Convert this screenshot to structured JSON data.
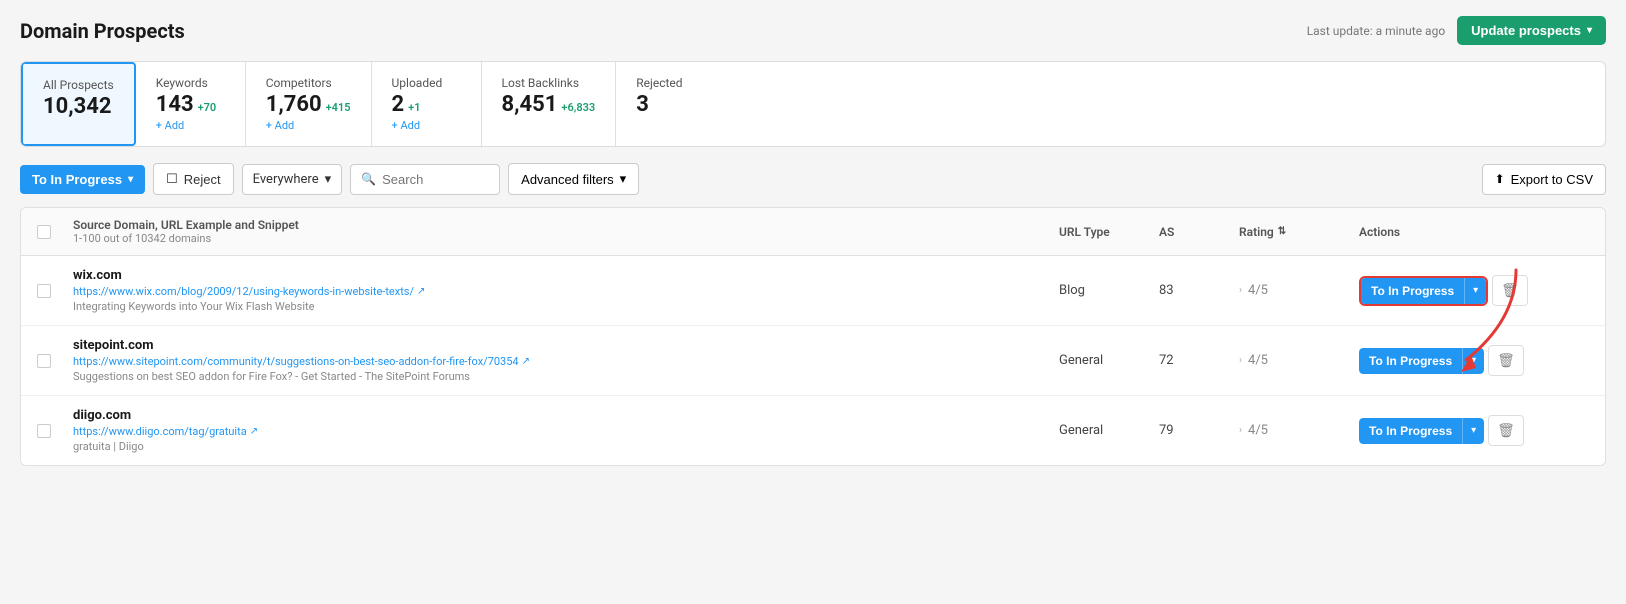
{
  "page": {
    "title": "Domain Prospects",
    "last_update": "Last update: a minute ago",
    "update_btn": "Update prospects"
  },
  "stats": [
    {
      "id": "all",
      "label": "All Prospects",
      "value": "10,342",
      "delta": "",
      "add": "",
      "active": true
    },
    {
      "id": "keywords",
      "label": "Keywords",
      "value": "143",
      "delta": "+70",
      "add": "+ Add",
      "active": false
    },
    {
      "id": "competitors",
      "label": "Competitors",
      "value": "1,760",
      "delta": "+415",
      "add": "+ Add",
      "active": false
    },
    {
      "id": "uploaded",
      "label": "Uploaded",
      "value": "2",
      "delta": "+1",
      "add": "+ Add",
      "active": false
    },
    {
      "id": "lost_backlinks",
      "label": "Lost Backlinks",
      "value": "8,451",
      "delta": "+6,833",
      "add": "",
      "active": false
    },
    {
      "id": "rejected",
      "label": "Rejected",
      "value": "3",
      "delta": "",
      "add": "",
      "active": false
    }
  ],
  "toolbar": {
    "to_in_progress": "To In Progress",
    "reject": "Reject",
    "everywhere": "Everywhere",
    "search_placeholder": "Search",
    "advanced_filters": "Advanced filters",
    "export": "Export to CSV"
  },
  "table": {
    "col_source": "Source Domain, URL Example and Snippet",
    "col_source_sub": "1-100 out of 10342 domains",
    "col_url_type": "URL Type",
    "col_as": "AS",
    "col_rating": "Rating",
    "col_actions": "Actions",
    "rows": [
      {
        "domain": "wix.com",
        "url": "https://www.wix.com/blog/2009/12/using-keywords-in-website-texts/",
        "snippet": "Integrating Keywords into Your Wix Flash Website",
        "url_type": "Blog",
        "as": "83",
        "rating": "4/5",
        "action": "To In Progress",
        "highlighted": true
      },
      {
        "domain": "sitepoint.com",
        "url": "https://www.sitepoint.com/community/t/suggestions-on-best-seo-addon-for-fire-fox/70354",
        "snippet": "Suggestions on best SEO addon for Fire Fox? - Get Started - The SitePoint Forums",
        "url_type": "General",
        "as": "72",
        "rating": "4/5",
        "action": "To In Progress",
        "highlighted": false
      },
      {
        "domain": "diigo.com",
        "url": "https://www.diigo.com/tag/gratuita",
        "snippet": "gratuita | Diigo",
        "url_type": "General",
        "as": "79",
        "rating": "4/5",
        "action": "To In Progress",
        "highlighted": false
      }
    ]
  },
  "icons": {
    "chevron_down": "▾",
    "external_link": "↗",
    "filter": "⇅",
    "search": "🔍",
    "reject_square": "▢",
    "trash": "🗑",
    "upload": "⬆"
  }
}
